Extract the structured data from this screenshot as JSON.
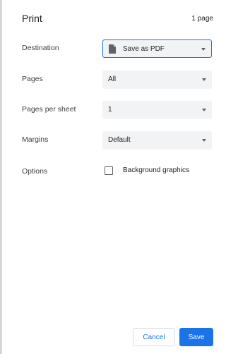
{
  "header": {
    "title": "Print",
    "page_count": "1 page"
  },
  "rows": {
    "destination": {
      "label": "Destination",
      "value": "Save as PDF",
      "icon": "document-icon"
    },
    "pages": {
      "label": "Pages",
      "value": "All"
    },
    "pages_per_sheet": {
      "label": "Pages per sheet",
      "value": "1"
    },
    "margins": {
      "label": "Margins",
      "value": "Default"
    },
    "options": {
      "label": "Options",
      "checkbox_label": "Background graphics",
      "checked": false
    }
  },
  "footer": {
    "cancel_label": "Cancel",
    "save_label": "Save"
  },
  "colors": {
    "accent": "#1a73e8",
    "field_bg": "#f1f3f4"
  }
}
